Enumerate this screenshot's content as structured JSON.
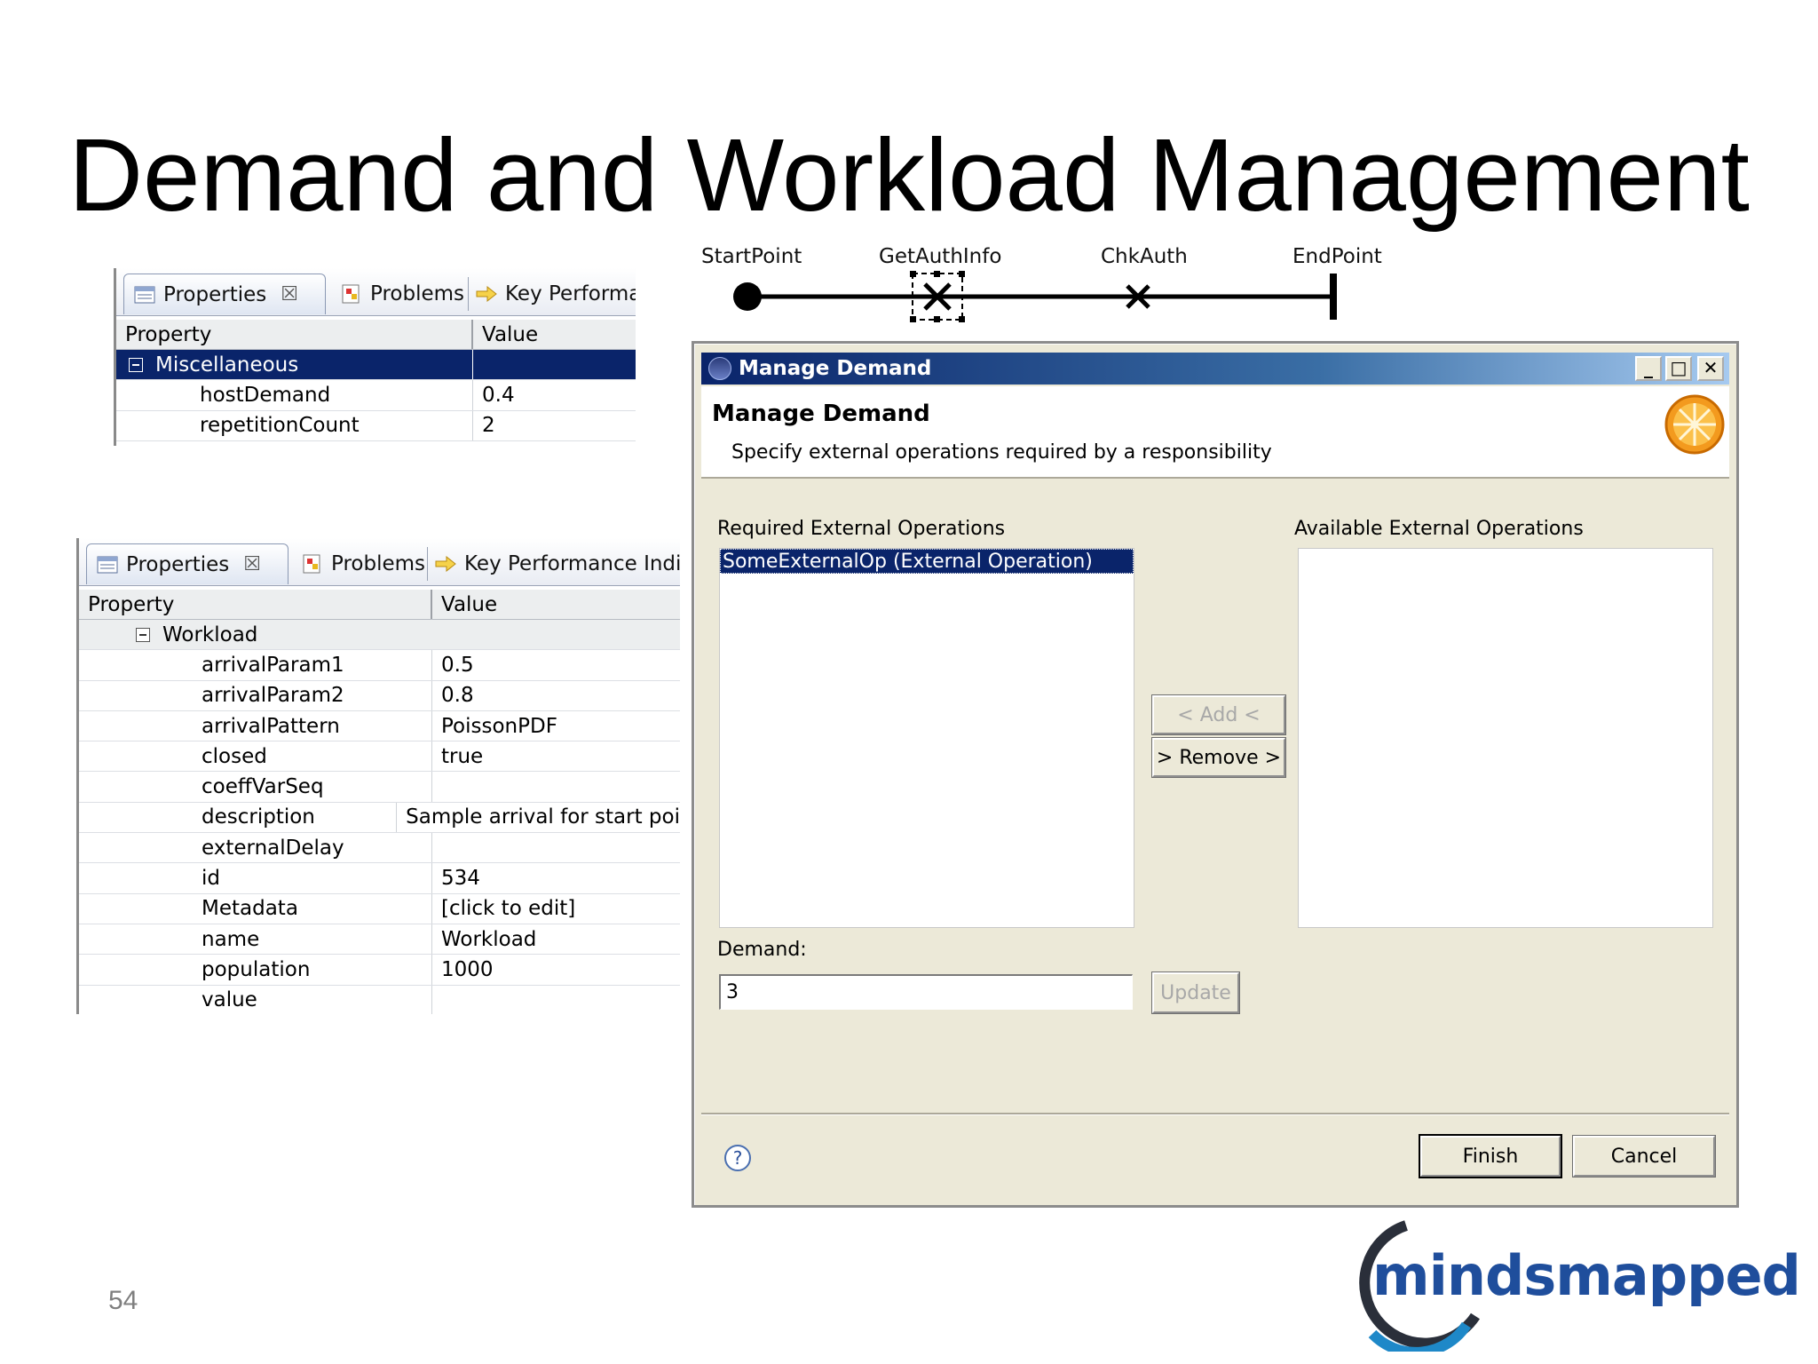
{
  "slide": {
    "title": "Demand and Workload Management",
    "page_number": "54"
  },
  "flow": {
    "nodes": [
      "StartPoint",
      "GetAuthInfo",
      "ChkAuth",
      "EndPoint"
    ]
  },
  "panel_top": {
    "tabs": [
      "Properties",
      "Problems",
      "Key Performa"
    ],
    "columns": [
      "Property",
      "Value"
    ],
    "group": "Miscellaneous",
    "rows": [
      {
        "property": "hostDemand",
        "value": "0.4"
      },
      {
        "property": "repetitionCount",
        "value": "2"
      }
    ]
  },
  "panel_bottom": {
    "tabs": [
      "Properties",
      "Problems",
      "Key Performance Indica"
    ],
    "columns": [
      "Property",
      "Value"
    ],
    "group": "Workload",
    "rows": [
      {
        "property": "arrivalParam1",
        "value": "0.5"
      },
      {
        "property": "arrivalParam2",
        "value": "0.8"
      },
      {
        "property": "arrivalPattern",
        "value": "PoissonPDF"
      },
      {
        "property": "closed",
        "value": "true"
      },
      {
        "property": "coeffVarSeq",
        "value": ""
      },
      {
        "property": "description",
        "value": "Sample arrival for start poi"
      },
      {
        "property": "externalDelay",
        "value": ""
      },
      {
        "property": "id",
        "value": "534"
      },
      {
        "property": "Metadata",
        "value": "[click to edit]"
      },
      {
        "property": "name",
        "value": "Workload"
      },
      {
        "property": "population",
        "value": "1000"
      },
      {
        "property": "value",
        "value": ""
      }
    ]
  },
  "dialog": {
    "window_title": "Manage Demand",
    "heading": "Manage Demand",
    "description": "Specify external operations required by a responsibility",
    "required_label": "Required External Operations",
    "available_label": "Available External Operations",
    "required_items": [
      "SomeExternalOp (External Operation)"
    ],
    "add_button": "< Add <",
    "remove_button": "> Remove >",
    "demand_label": "Demand:",
    "demand_value": "3",
    "update_button": "Update",
    "finish_button": "Finish",
    "cancel_button": "Cancel",
    "window_controls": {
      "minimize": "_",
      "maximize": "□",
      "close": "✕"
    }
  },
  "logo": {
    "text": "mindsmapped"
  },
  "colors": {
    "selection": "#0a246a",
    "dialog_bg": "#ece9d8",
    "logo_blue": "#1f4e9c"
  }
}
